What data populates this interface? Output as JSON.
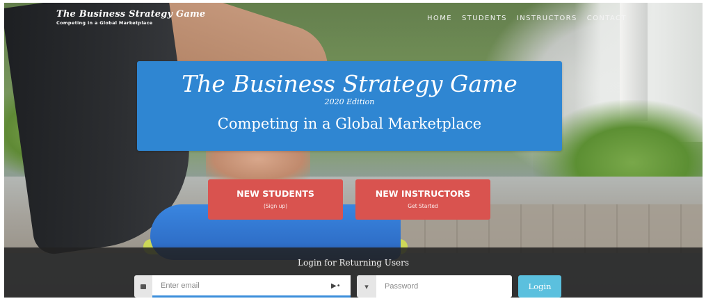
{
  "brand": {
    "title": "The Business Strategy Game",
    "subtitle": "Competing in a Global Marketplace"
  },
  "nav": {
    "items": [
      {
        "label": "HOME"
      },
      {
        "label": "STUDENTS"
      },
      {
        "label": "INSTRUCTORS"
      },
      {
        "label": "CONTACT"
      }
    ]
  },
  "hero": {
    "title": "The Business Strategy Game",
    "edition": "2020 Edition",
    "tagline": "Competing in a Global Marketplace"
  },
  "cta": {
    "students": {
      "label": "NEW STUDENTS",
      "sub": "(Sign up)"
    },
    "instructors": {
      "label": "NEW INSTRUCTORS",
      "sub": "Get Started"
    }
  },
  "login": {
    "heading": "Login for Returning Users",
    "email_placeholder": "Enter email",
    "password_placeholder": "Password",
    "button_label": "Login"
  },
  "colors": {
    "title_box": "#2f86d2",
    "cta": "#d9534f",
    "login_button": "#5bc0de"
  },
  "icons": [
    "envelope-icon",
    "key-icon",
    "password-manager-icon"
  ]
}
